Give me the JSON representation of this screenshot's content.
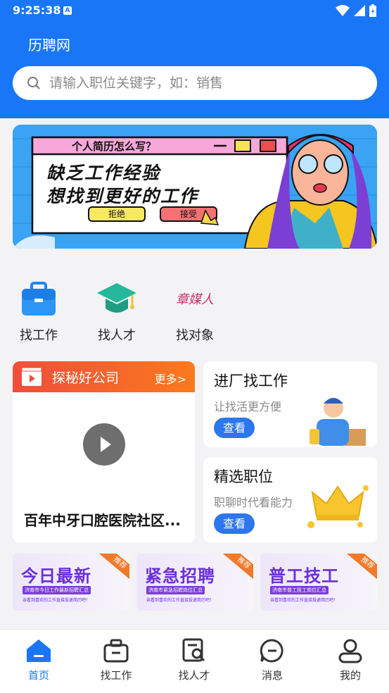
{
  "status": {
    "time": "9:25:38",
    "a_badge": "A"
  },
  "header": {
    "title": "历聘网"
  },
  "search": {
    "placeholder": "请输入职位关键字，如：销售"
  },
  "banner": {
    "window_title": "个人简历怎么写？",
    "line1": "缺乏工作经验",
    "line2": "想找到更好的工作",
    "reject": "拒绝",
    "accept": "接受"
  },
  "quick": [
    {
      "label": "找工作",
      "icon": "briefcase-icon"
    },
    {
      "label": "找人才",
      "icon": "graduation-cap-icon"
    },
    {
      "label": "找对象",
      "icon": "zhangmeiren-logo",
      "logo_text": "章媒人"
    }
  ],
  "video": {
    "title": "探秘好公司",
    "more": "更多>",
    "caption": "百年中牙口腔医院社区..."
  },
  "side_cards": [
    {
      "title": "进厂找工作",
      "subtitle": "让找活更方便",
      "button": "查看"
    },
    {
      "title": "精选职位",
      "subtitle": "职聊时代看能力",
      "button": "查看"
    }
  ],
  "promos": [
    {
      "title": "今日最新",
      "tag": "推荐",
      "line1": "济南市今日工作最新招聘汇总",
      "line2": "亲看到喜欢的工作直接投递简历吧！"
    },
    {
      "title": "紧急招聘",
      "tag": "推荐",
      "line1": "济南市紧急招聘岗位汇总",
      "line2": "亲看到喜欢的工作直接投递简历吧！"
    },
    {
      "title": "普工技工",
      "tag": "推荐",
      "line1": "济南市普工技工岗位汇总",
      "line2": "亲看到喜欢的工作直接投递简历吧！"
    }
  ],
  "tabs": [
    {
      "label": "首页",
      "icon": "home-icon",
      "active": true
    },
    {
      "label": "找工作",
      "icon": "briefcase-icon"
    },
    {
      "label": "找人才",
      "icon": "resume-search-icon"
    },
    {
      "label": "消息",
      "icon": "chat-bubble-icon"
    },
    {
      "label": "我的",
      "icon": "user-icon"
    }
  ],
  "colors": {
    "primary": "#1976f7",
    "accent": "#f04d3b",
    "promo": "#6a2fd8"
  }
}
